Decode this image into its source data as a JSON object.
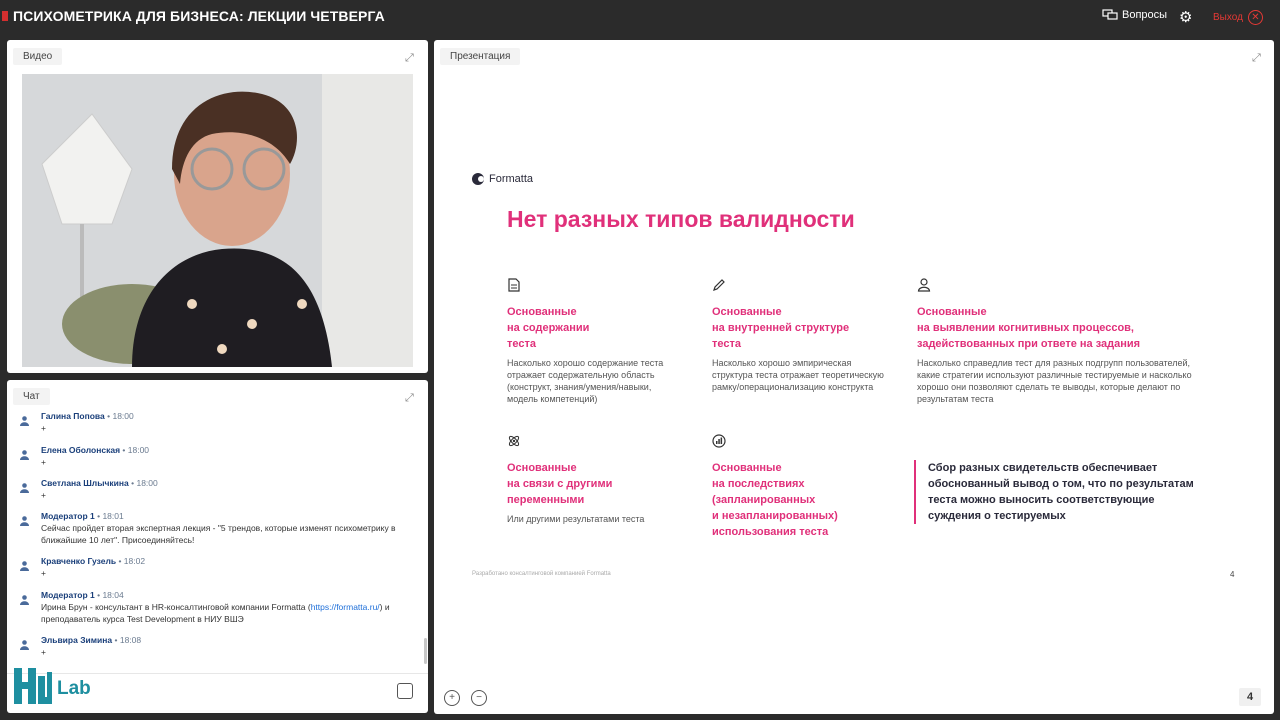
{
  "topbar": {
    "title": "ПСИХОМЕТРИКА ДЛЯ БИЗНЕСА: ЛЕКЦИИ ЧЕТВЕРГА",
    "questions_label": "Вопросы",
    "exit_label": "Выход",
    "icons": [
      "questions-icon",
      "gear-icon",
      "exit-icon"
    ]
  },
  "video": {
    "tab_label": "Видео"
  },
  "chat": {
    "tab_label": "Чат",
    "messages": [
      {
        "author": "Галина Попова",
        "time": "18:00",
        "text": "+"
      },
      {
        "author": "Елена Оболонская",
        "time": "18:00",
        "text": "+"
      },
      {
        "author": "Светлана Шлычкина",
        "time": "18:00",
        "text": "+"
      },
      {
        "author": "Модератор 1",
        "time": "18:01",
        "text": "Сейчас пройдет вторая экспертная лекция - \"5 трендов, которые изменят психометрику в ближайшие 10 лет\". Присоединяйтесь!"
      },
      {
        "author": "Кравченко Гузель",
        "time": "18:02",
        "text": "+"
      },
      {
        "author": "Модератор 1",
        "time": "18:04",
        "text_before": "Ирина Брун - консультант в HR-консалтинговой компании Formatta (",
        "link": "https://formatta.ru/",
        "text_after": ") и преподаватель курса Test Development в НИУ ВШЭ"
      },
      {
        "author": "Эльвира Зимина",
        "time": "18:08",
        "text": "+"
      }
    ],
    "logo_text": "Lab"
  },
  "presentation": {
    "tab_label": "Презентация",
    "page_number": "4",
    "slide": {
      "brand": "Formatta",
      "title": "Нет разных типов валидности",
      "columns": [
        {
          "heading_lines": [
            "Основанные",
            "на содержании",
            "теста"
          ],
          "desc": "Насколько хорошо содержание теста отражает содержательную область (конструкт, знания/умения/навыки, модель компетенций)"
        },
        {
          "heading_lines": [
            "Основанные",
            "на внутренней структуре",
            "теста"
          ],
          "desc": "Насколько хорошо эмпирическая структура теста отражает теоретическую рамку/операционализацию конструкта"
        },
        {
          "heading_lines": [
            "Основанные",
            "на выявлении когнитивных процессов,",
            "задействованных при ответе на задания"
          ],
          "desc": "Насколько справедлив тест для разных подгрупп пользователей, какие стратегии используют различные тестируемые и насколько хорошо они позволяют сделать те выводы, которые делают по результатам теста"
        },
        {
          "heading_lines": [
            "Основанные",
            "на связи с другими",
            "переменными"
          ],
          "desc": "Или другими результатами теста"
        },
        {
          "heading_lines": [
            "Основанные",
            "на последствиях",
            "(запланированных",
            "и незапланированных)",
            "использования теста"
          ],
          "desc": ""
        }
      ],
      "quote": "Сбор разных свидетельств обеспечивает обоснованный вывод о том, что по результатам теста можно выносить соответствующие суждения о тестируемых",
      "footer": "Разработано консалтинговой компанией Formatta",
      "slide_number": "4"
    }
  }
}
